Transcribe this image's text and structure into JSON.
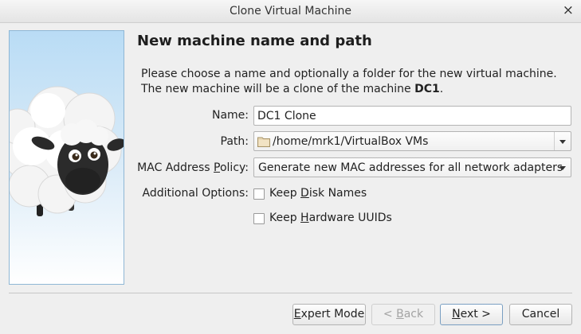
{
  "window": {
    "title": "Clone Virtual Machine",
    "close_glyph": "×"
  },
  "page": {
    "heading": "New machine name and path",
    "desc_text": "Please choose a name and optionally a folder for the new virtual machine. The new machine will be a clone of the machine ",
    "source_machine": "DC1",
    "desc_end": "."
  },
  "form": {
    "name_label": "Name:",
    "name_value": "DC1 Clone",
    "path_label": "Path:",
    "path_value": "/home/mrk1/VirtualBox VMs",
    "mac_label_pre": "MAC Address ",
    "mac_label_ul": "P",
    "mac_label_post": "olicy:",
    "mac_value": "Generate new MAC addresses for all network adapters",
    "options_label": "Additional Options:",
    "keep_disk_pre": "Keep ",
    "keep_disk_ul": "D",
    "keep_disk_post": "isk Names",
    "keep_disk_checked": false,
    "keep_hw_pre": "Keep ",
    "keep_hw_ul": "H",
    "keep_hw_post": "ardware UUIDs",
    "keep_hw_checked": false
  },
  "buttons": {
    "expert_pre": "",
    "expert_ul": "E",
    "expert_post": "xpert Mode",
    "back_pre": "< ",
    "back_ul": "B",
    "back_post": "ack",
    "next_pre": "",
    "next_ul": "N",
    "next_post": "ext >",
    "cancel": "Cancel"
  },
  "icons": {
    "close": "close-icon",
    "folder": "folder-icon",
    "dropdown": "chevron-down-icon",
    "wizard_image": "sheep-illustration"
  }
}
